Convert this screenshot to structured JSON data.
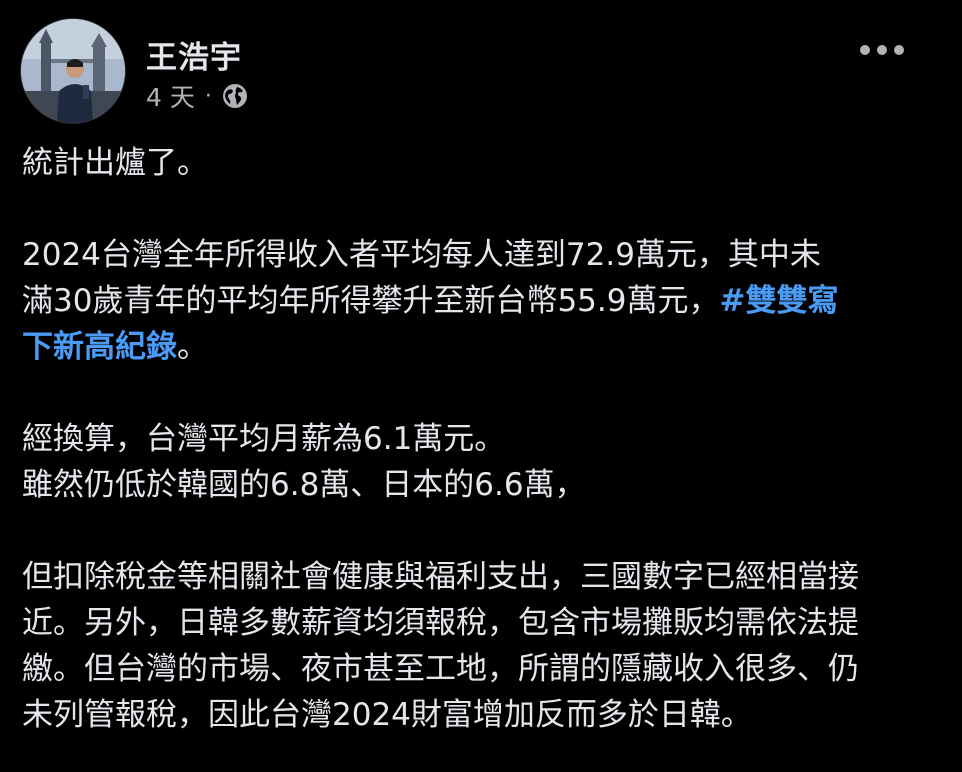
{
  "post": {
    "author_name": "王浩宇",
    "time_ago": "4 天",
    "separator": "·",
    "privacy_icon": "globe-icon",
    "more_icon": "more-horizontal-icon",
    "paragraphs": {
      "p1": "統計出爐了。",
      "p2_line1": "2024台灣全年所得收入者平均每人達到72.9萬元，其中未",
      "p2_line2_text": "滿30歲青年的平均年所得攀升至新台幣55.9萬元，",
      "p2_hashtag_part1": "#雙雙寫",
      "p2_hashtag_part2": "下新高紀錄",
      "p2_end": "。",
      "p3_line1": "經換算，台灣平均月薪為6.1萬元。",
      "p3_line2": "雖然仍低於韓國的6.8萬、日本的6.6萬，",
      "p4_line1": "但扣除稅金等相關社會健康與福利支出，三國數字已經相當接",
      "p4_line2": "近。另外，日韓多數薪資均須報稅，包含市場攤販均需依法提",
      "p4_line3": "繳。但台灣的市場、夜市甚至工地，所謂的隱藏收入很多、仍",
      "p4_line4": "未列管報稅，因此台灣2024財富增加反而多於日韓。"
    }
  },
  "colors": {
    "background": "#000000",
    "text_primary": "#e4e6eb",
    "text_secondary": "#b0b3b8",
    "hashtag": "#4a9bf5"
  }
}
